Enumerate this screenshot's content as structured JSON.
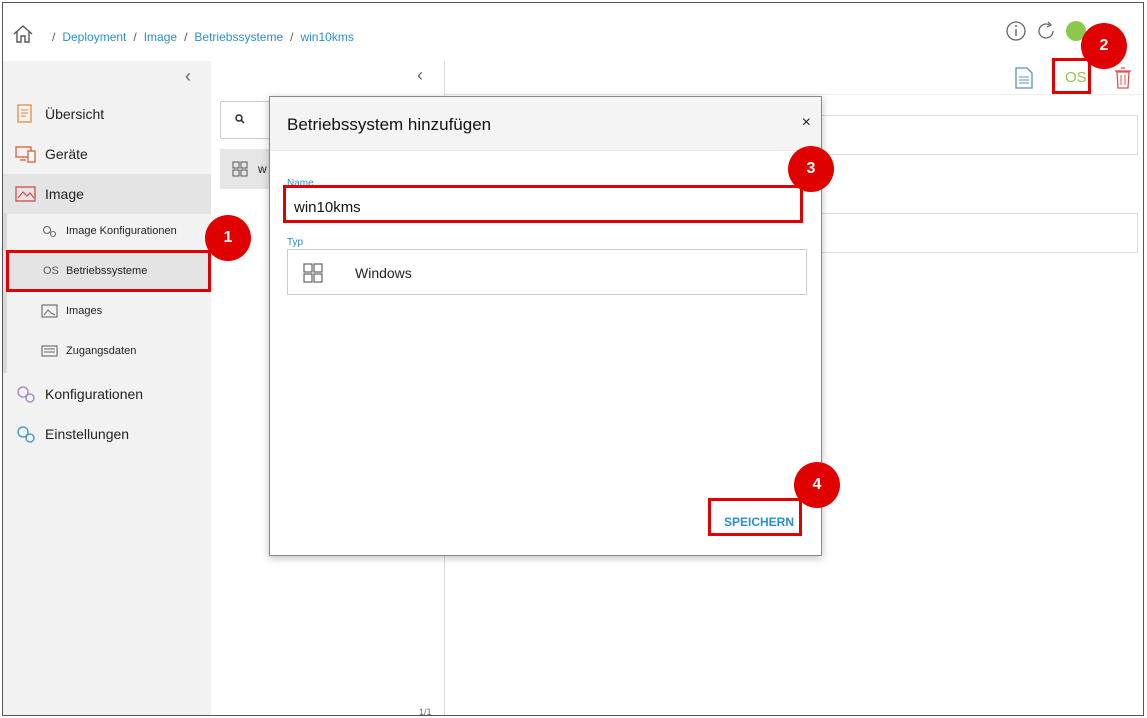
{
  "breadcrumb": {
    "items": [
      "Deployment",
      "Image",
      "Betriebssysteme",
      "win10kms"
    ]
  },
  "sidebar": {
    "items": [
      {
        "label": "Übersicht",
        "icon": "overview-icon"
      },
      {
        "label": "Geräte",
        "icon": "devices-icon"
      },
      {
        "label": "Image",
        "icon": "image-icon"
      },
      {
        "label": "Konfigurationen",
        "icon": "configurations-icon"
      },
      {
        "label": "Einstellungen",
        "icon": "settings-icon"
      }
    ],
    "subitems": [
      {
        "label": "Image Konfigurationen",
        "icon": "gears-icon"
      },
      {
        "label": "Betriebssysteme",
        "icon_text": "OS"
      },
      {
        "label": "Images",
        "icon": "images-icon"
      },
      {
        "label": "Zugangsdaten",
        "icon": "credentials-icon"
      }
    ]
  },
  "list": {
    "row_text": "w",
    "pager": "1/1"
  },
  "toolbar": {
    "os_label": "OS"
  },
  "modal": {
    "title": "Betriebssystem hinzufügen",
    "close": "×",
    "name_label": "Name",
    "name_value": "win10kms",
    "type_label": "Typ",
    "type_value": "Windows",
    "save_label": "SPEICHERN"
  },
  "annotations": {
    "badge1": "1",
    "badge2": "2",
    "badge3": "3",
    "badge4": "4"
  },
  "colors": {
    "accent": "#2a8fd0",
    "highlight": "#e00000",
    "os_green": "#8cc84b"
  }
}
